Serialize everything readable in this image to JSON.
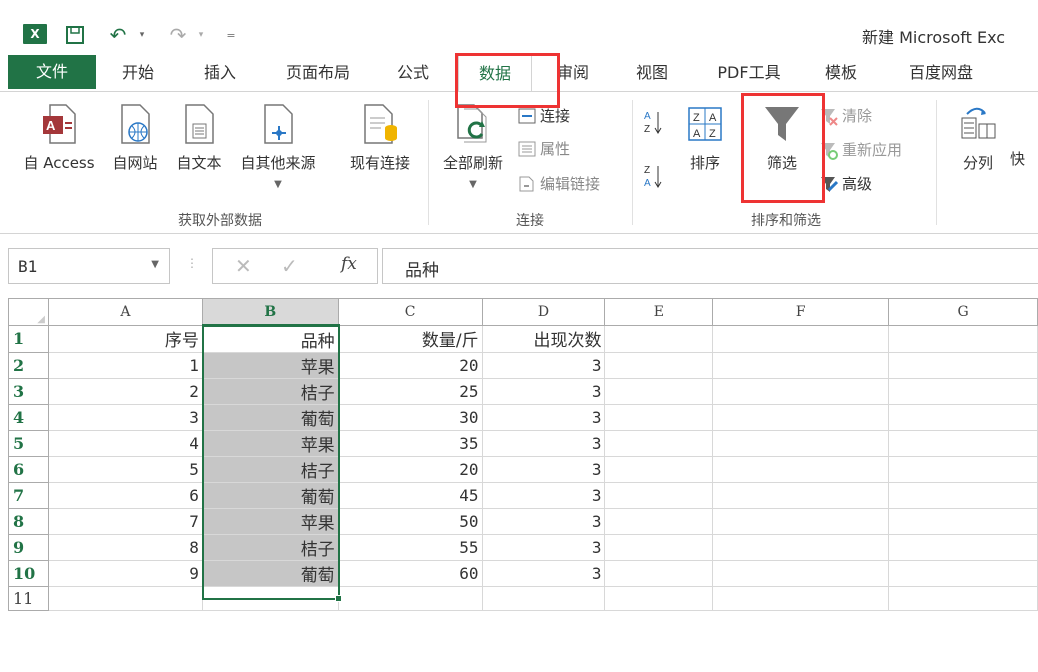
{
  "window": {
    "title": "新建 Microsoft Exc"
  },
  "quick_access": {
    "logo_text": "X",
    "icons": [
      "excel-logo",
      "save-icon",
      "undo-icon",
      "redo-icon",
      "customize-icon"
    ]
  },
  "tabs": [
    {
      "key": "file",
      "label": "文件"
    },
    {
      "key": "home",
      "label": "开始"
    },
    {
      "key": "insert",
      "label": "插入"
    },
    {
      "key": "layout",
      "label": "页面布局"
    },
    {
      "key": "formulas",
      "label": "公式"
    },
    {
      "key": "data",
      "label": "数据"
    },
    {
      "key": "review",
      "label": "审阅"
    },
    {
      "key": "view",
      "label": "视图"
    },
    {
      "key": "pdf",
      "label": "PDF工具"
    },
    {
      "key": "template",
      "label": "模板"
    },
    {
      "key": "baidu",
      "label": "百度网盘"
    }
  ],
  "ribbon": {
    "external": {
      "access": "自 Access",
      "web": "自网站",
      "text": "自文本",
      "other": "自其他来源",
      "existing": "现有连接",
      "group_label": "获取外部数据"
    },
    "connections": {
      "refresh_all": "全部刷新",
      "connections": "连接",
      "properties": "属性",
      "edit_links": "编辑链接",
      "group_label": "连接"
    },
    "sort_filter": {
      "sort": "排序",
      "filter": "筛选",
      "clear": "清除",
      "reapply": "重新应用",
      "advanced": "高级",
      "group_label": "排序和筛选"
    },
    "data_tools": {
      "split": "分列",
      "flash": "快"
    }
  },
  "formula_bar": {
    "name_box": "B1",
    "fx": "fx",
    "value": "品种"
  },
  "sheet": {
    "columns": [
      "A",
      "B",
      "C",
      "D",
      "E",
      "F",
      "G"
    ],
    "selected_column": "B",
    "rows": [
      {
        "n": "1",
        "a": "序号",
        "b": "品种",
        "c": "数量/斤",
        "d": "出现次数"
      },
      {
        "n": "2",
        "a": "1",
        "b": "苹果",
        "c": "20",
        "d": "3"
      },
      {
        "n": "3",
        "a": "2",
        "b": "桔子",
        "c": "25",
        "d": "3"
      },
      {
        "n": "4",
        "a": "3",
        "b": "葡萄",
        "c": "30",
        "d": "3"
      },
      {
        "n": "5",
        "a": "4",
        "b": "苹果",
        "c": "35",
        "d": "3"
      },
      {
        "n": "6",
        "a": "5",
        "b": "桔子",
        "c": "20",
        "d": "3"
      },
      {
        "n": "7",
        "a": "6",
        "b": "葡萄",
        "c": "45",
        "d": "3"
      },
      {
        "n": "8",
        "a": "7",
        "b": "苹果",
        "c": "50",
        "d": "3"
      },
      {
        "n": "9",
        "a": "8",
        "b": "桔子",
        "c": "55",
        "d": "3"
      },
      {
        "n": "10",
        "a": "9",
        "b": "葡萄",
        "c": "60",
        "d": "3"
      },
      {
        "n": "11",
        "a": "",
        "b": "",
        "c": "",
        "d": ""
      }
    ]
  },
  "colors": {
    "accent": "#217346",
    "highlight": "#e33333",
    "selection": "#c6c6c6"
  }
}
